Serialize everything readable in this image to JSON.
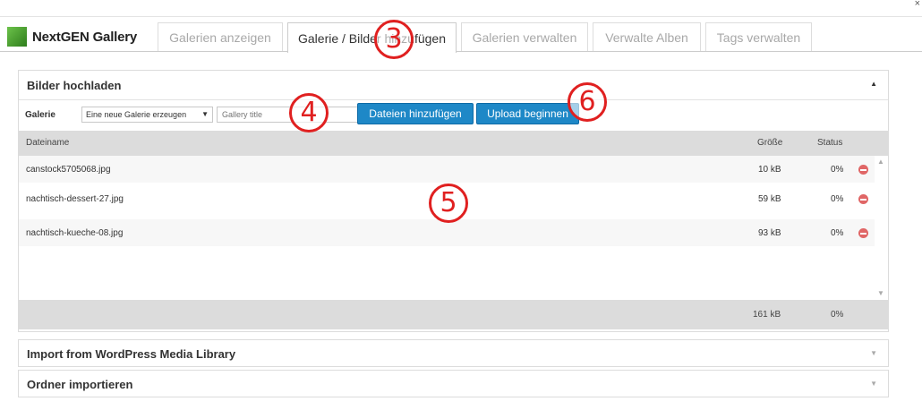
{
  "brand": {
    "name": "NextGEN Gallery"
  },
  "window": {
    "close_glyph": "×"
  },
  "tabs": [
    {
      "label": "Galerien anzeigen",
      "active": false
    },
    {
      "label": "Galerie / Bilder hinzufügen",
      "active": true
    },
    {
      "label": "Galerien verwalten",
      "active": false
    },
    {
      "label": "Verwalte Alben",
      "active": false
    },
    {
      "label": "Tags verwalten",
      "active": false
    }
  ],
  "upload_panel": {
    "title": "Bilder hochladen",
    "gallery_label": "Galerie",
    "gallery_select_value": "Eine neue Galerie erzeugen",
    "gallery_title_placeholder": "Gallery title",
    "add_files_button": "Dateien hinzufügen",
    "start_upload_button": "Upload beginnen",
    "columns": {
      "filename": "Dateiname",
      "size": "Größe",
      "status": "Status"
    },
    "files": [
      {
        "name": "canstock5705068.jpg",
        "size": "10 kB",
        "status": "0%"
      },
      {
        "name": "nachtisch-dessert-27.jpg",
        "size": "59 kB",
        "status": "0%"
      },
      {
        "name": "nachtisch-kueche-08.jpg",
        "size": "93 kB",
        "status": "0%"
      }
    ],
    "total_size": "161 kB",
    "total_status": "0%"
  },
  "collapsed_panels": [
    {
      "title": "Import from WordPress Media Library"
    },
    {
      "title": "Ordner importieren"
    }
  ],
  "annotations": [
    "3",
    "4",
    "5",
    "6"
  ],
  "colors": {
    "accent_button": "#1e88c7",
    "annotation_red": "#e02020",
    "remove_icon": "#e06666"
  }
}
